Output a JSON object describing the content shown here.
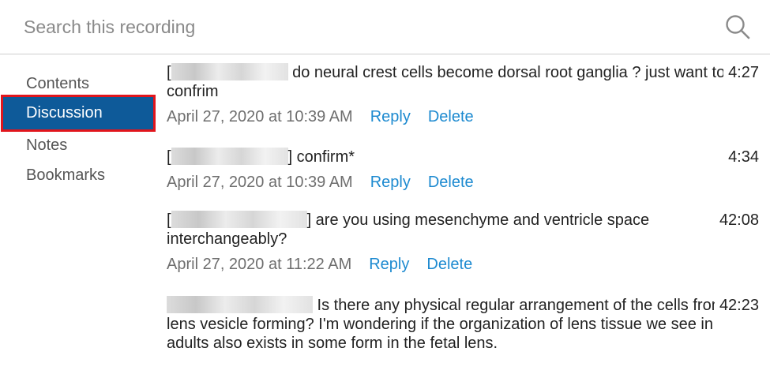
{
  "search": {
    "placeholder": "Search this recording",
    "icon": "search-icon"
  },
  "sidebar": {
    "items": [
      {
        "label": "Contents",
        "active": false
      },
      {
        "label": "Discussion",
        "active": true
      },
      {
        "label": "Notes",
        "active": false
      },
      {
        "label": "Bookmarks",
        "active": false
      }
    ]
  },
  "colors": {
    "active_bg": "#0e5a99",
    "active_outline": "#e1151c",
    "link": "#1d8ad0"
  },
  "comments": [
    {
      "prefix": "[",
      "text": " do neural crest cells become dorsal root ganglia ? just want to confrim",
      "time": "4:27",
      "date": "April 27, 2020 at 10:39 AM",
      "reply": "Reply",
      "delete": "Delete"
    },
    {
      "prefix": "[",
      "text": "] confirm*",
      "time": "4:34",
      "date": "April 27, 2020 at 10:39 AM",
      "reply": "Reply",
      "delete": "Delete"
    },
    {
      "prefix": "[",
      "text": "] are you using mesenchyme and ventricle space interchangeably?",
      "time": "42:08",
      "date": "April 27, 2020 at 11:22 AM",
      "reply": "Reply",
      "delete": "Delete"
    },
    {
      "prefix": "",
      "text": " Is there any physical regular arrangement of the cells from the lens vesicle forming? I'm wondering if the organization of lens tissue we see in adults also exists in some form in the fetal lens.",
      "time": "42:23"
    }
  ]
}
